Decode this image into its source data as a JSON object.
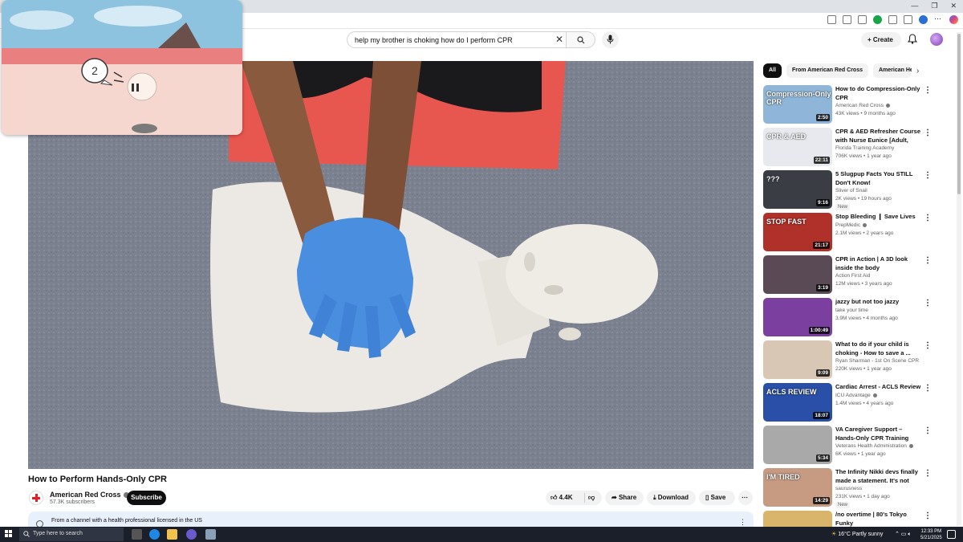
{
  "search": {
    "query": "help my brother is choking how do I perform CPR"
  },
  "header": {
    "create_label": "Create"
  },
  "video": {
    "title": "How to Perform Hands-Only CPR",
    "channel": "American Red Cross",
    "subscribers": "57.3K subscribers",
    "subscribe_label": "Subscribe",
    "likes": "4.4K",
    "share_label": "Share",
    "download_label": "Download",
    "save_label": "Save",
    "health_notice": "From a channel with a health professional licensed in the US"
  },
  "mini_overlay": {
    "counter": "2"
  },
  "chips": [
    "All",
    "From American Red Cross",
    "American Hea"
  ],
  "recommendations": [
    {
      "title": "How to do Compression-Only CPR",
      "channel": "American Red Cross",
      "meta": "43K views • 9 months ago",
      "duration": "2:50",
      "verified": true,
      "new": false,
      "thumb_color": "#8fb6d8",
      "thumb_text": "Compression-Only CPR"
    },
    {
      "title": "CPR & AED Refresher Course with Nurse Eunice [Adult, Child...",
      "channel": "Florida Training Academy",
      "meta": "706K views • 1 year ago",
      "duration": "22:11",
      "verified": false,
      "new": false,
      "thumb_color": "#e7e9ee",
      "thumb_text": "CPR & AED"
    },
    {
      "title": "5 Slugpup Facts You STILL Don't Know!",
      "channel": "Sliver of Snail",
      "meta": "2K views • 19 hours ago",
      "duration": "9:16",
      "verified": false,
      "new": true,
      "thumb_color": "#3a3e44",
      "thumb_text": "???"
    },
    {
      "title": "Stop Bleeding ❙ Save Lives",
      "channel": "PrepMedic",
      "meta": "2.1M views • 2 years ago",
      "duration": "21:17",
      "verified": true,
      "new": false,
      "thumb_color": "#b0302a",
      "thumb_text": "STOP FAST"
    },
    {
      "title": "CPR in Action | A 3D look inside the body",
      "channel": "Action First Aid",
      "meta": "12M views • 3 years ago",
      "duration": "3:19",
      "verified": false,
      "new": false,
      "thumb_color": "#5a4a55",
      "thumb_text": ""
    },
    {
      "title": "jazzy but not too jazzy",
      "channel": "take your time",
      "meta": "3.9M views • 4 months ago",
      "duration": "1:00:49",
      "verified": false,
      "new": false,
      "thumb_color": "#7b3fa0",
      "thumb_text": ""
    },
    {
      "title": "What to do if your child is choking - How to save a ...",
      "channel": "Ryan Sharman - 1st On Scene CPR",
      "meta": "220K views • 1 year ago",
      "duration": "9:09",
      "verified": false,
      "new": false,
      "thumb_color": "#d8c7b4",
      "thumb_text": ""
    },
    {
      "title": "Cardiac Arrest - ACLS Review",
      "channel": "ICU Advantage",
      "meta": "1.4M views • 4 years ago",
      "duration": "18:07",
      "verified": true,
      "new": false,
      "thumb_color": "#2a4fa8",
      "thumb_text": "ACLS REVIEW"
    },
    {
      "title": "VA Caregiver Support – Hands-Only CPR Training",
      "channel": "Veterans Health Administration",
      "meta": "6K views • 1 year ago",
      "duration": "5:34",
      "verified": true,
      "new": false,
      "thumb_color": "#a9a9a9",
      "thumb_text": ""
    },
    {
      "title": "The Infinity Nikki devs finally made a statement. It's not very...",
      "channel": "saurusness",
      "meta": "231K views • 1 day ago",
      "duration": "14:29",
      "verified": false,
      "new": true,
      "thumb_color": "#c79a82",
      "thumb_text": "I'M TIRED"
    },
    {
      "title": "/no overtime | 80's Tokyo Funky",
      "channel": "",
      "meta": "",
      "duration": "",
      "verified": false,
      "new": false,
      "thumb_color": "#d9b56c",
      "thumb_text": ""
    }
  ],
  "taskbar": {
    "search_placeholder": "Type here to search",
    "weather": "16°C  Partly sunny",
    "time": "12:33 PM",
    "date": "5/21/2025"
  }
}
